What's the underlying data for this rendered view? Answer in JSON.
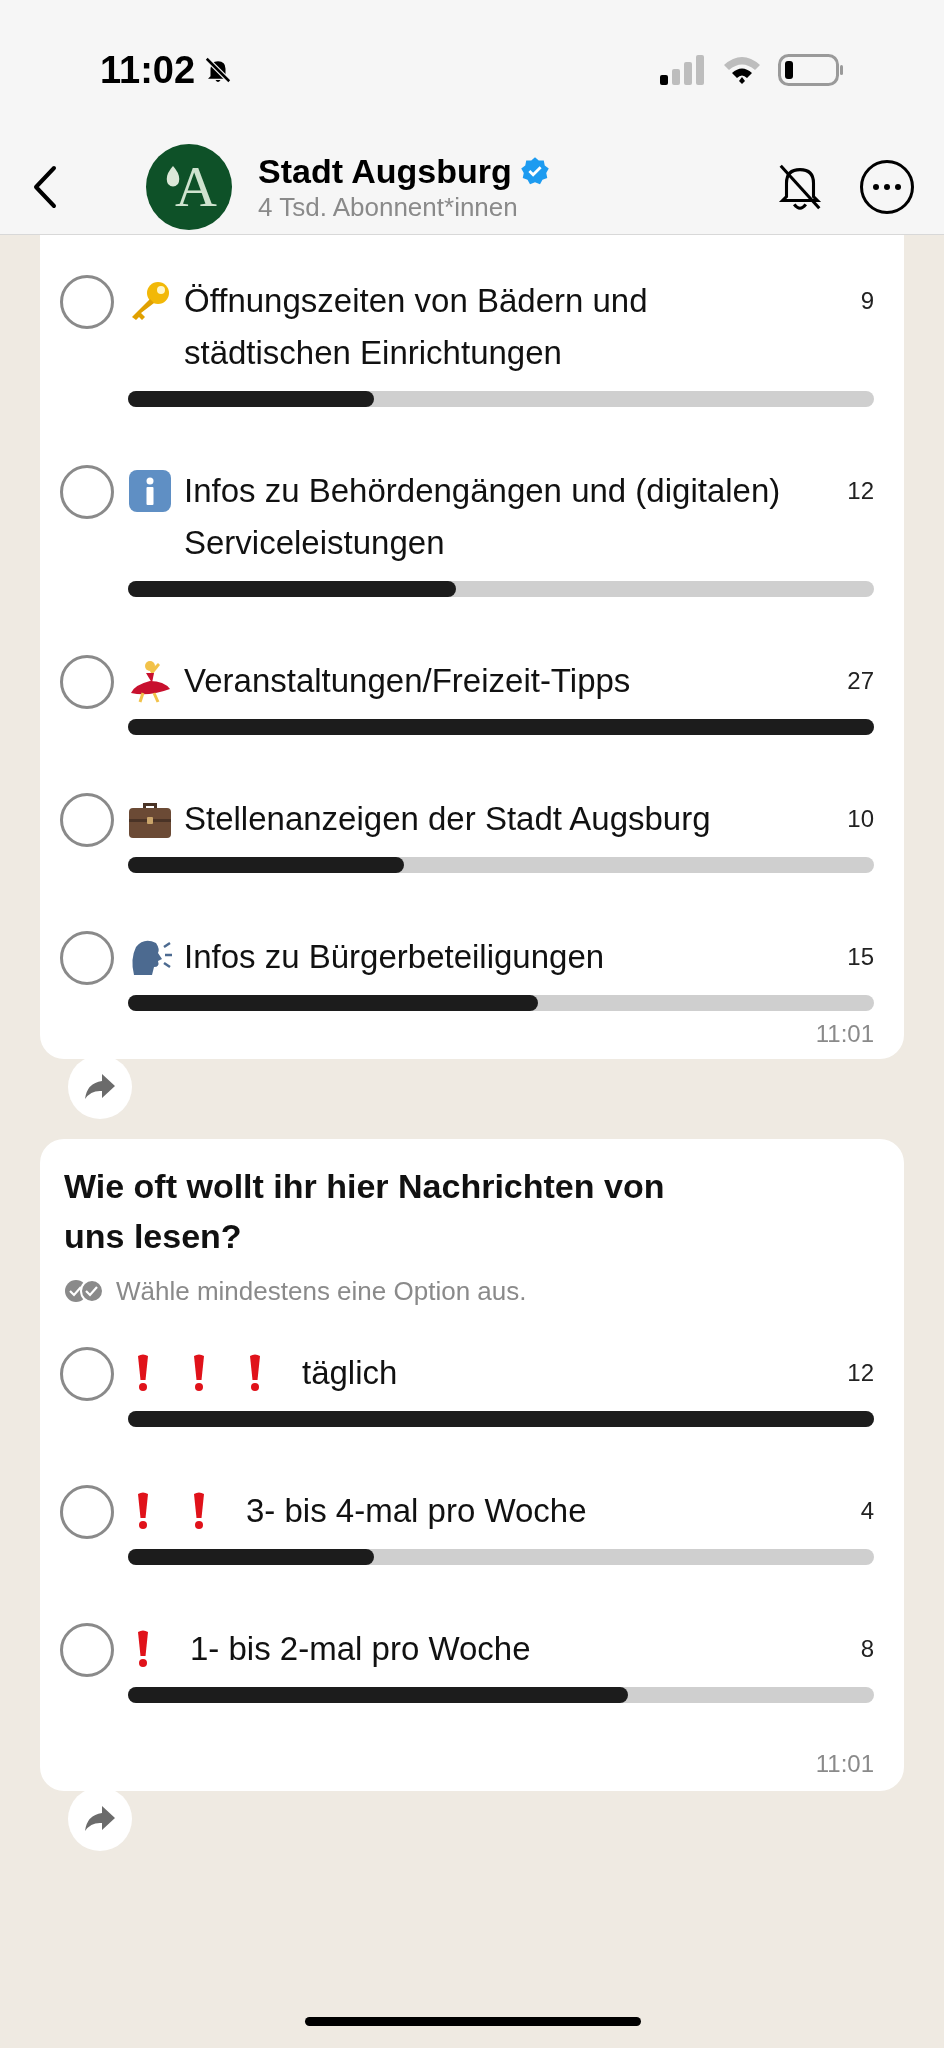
{
  "status_bar": {
    "time": "11:02"
  },
  "header": {
    "avatar_letter": "A",
    "title": "Stadt Augsburg",
    "verified": true,
    "subtitle": "4 Tsd. Abonnent*innen"
  },
  "polls": [
    {
      "options": [
        {
          "kind": "key",
          "label": "Öffnungszeiten von Bädern und städtischen Einrichtungen",
          "count": "9",
          "selected": false,
          "level": 0.33
        },
        {
          "kind": "info",
          "label": "Infos zu Behördengängen und (digitalen) Serviceleistungen",
          "count": "12",
          "selected": false,
          "level": 0.44
        },
        {
          "kind": "dancer",
          "label": "Veranstaltungen/Freizeit-Tipps",
          "count": "27",
          "selected": false,
          "level": 1
        },
        {
          "kind": "briefcase",
          "label": "Stellenanzeigen der Stadt Augsburg",
          "count": "10",
          "selected": false,
          "level": 0.37
        },
        {
          "kind": "speaker",
          "label": "Infos zu Bürgerbeteiligungen",
          "count": "15",
          "selected": false,
          "level": 0.55
        }
      ],
      "time": "11:01"
    },
    {
      "question": "Wie oft wollt ihr hier Nachrichten von uns lesen?",
      "hint": "Wähle mindestens eine Option aus.",
      "options": [
        {
          "kind": "alert3",
          "label": "täglich",
          "count": "12",
          "selected": false,
          "level": 1
        },
        {
          "kind": "alert2",
          "label": "3- bis 4-mal pro Woche",
          "count": "4",
          "selected": false,
          "level": 0.33
        },
        {
          "kind": "alert1",
          "label": "1- bis 2-mal pro Woche",
          "count": "8",
          "selected": false,
          "level": 0.67
        }
      ],
      "time": "11:01"
    }
  ]
}
